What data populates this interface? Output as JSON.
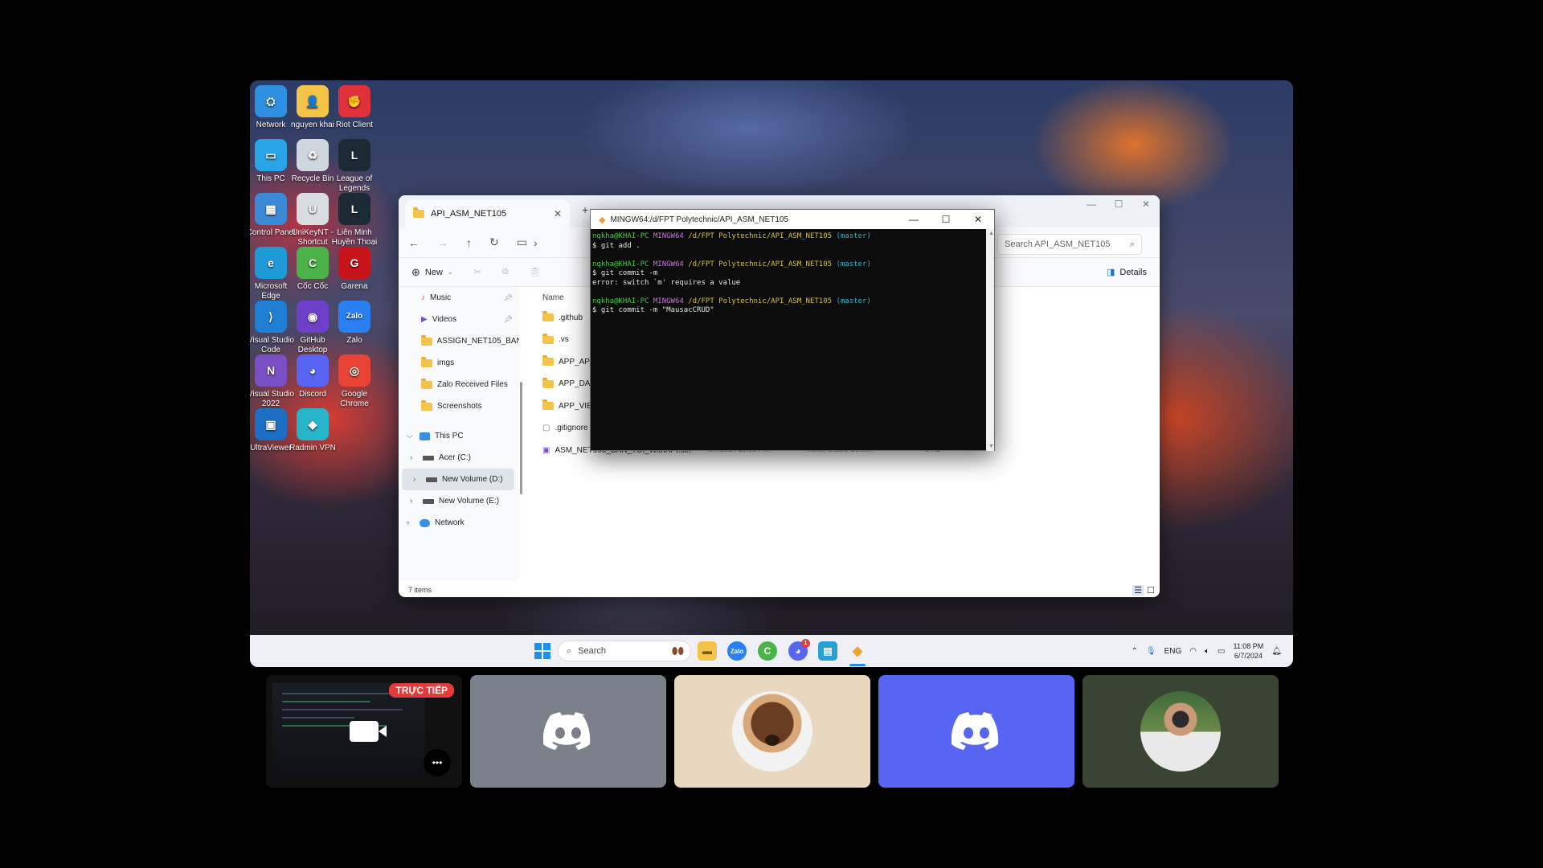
{
  "desktop_icons": [
    {
      "label": "Network",
      "glyph": "⛭",
      "color": "#2f8fe0"
    },
    {
      "label": "nguyen khai",
      "glyph": "👤",
      "color": "#f3c34a"
    },
    {
      "label": "Riot Client",
      "glyph": "✊",
      "color": "#e0313b"
    },
    {
      "label": "This PC",
      "glyph": "▭",
      "color": "#2aa4e8"
    },
    {
      "label": "Recycle Bin",
      "glyph": "♻",
      "color": "#cfd6de"
    },
    {
      "label": "League of Legends",
      "glyph": "L",
      "color": "#1c2a36"
    },
    {
      "label": "Control Panel",
      "glyph": "▦",
      "color": "#3b89d6"
    },
    {
      "label": "UniKeyNT - Shortcut",
      "glyph": "U",
      "color": "#d9dde2"
    },
    {
      "label": "Liên Minh Huyền Thoại",
      "glyph": "L",
      "color": "#1c2a36"
    },
    {
      "label": "Microsoft Edge",
      "glyph": "e",
      "color": "#1e9bd6"
    },
    {
      "label": "Cốc Cốc",
      "glyph": "C",
      "color": "#4cb34a"
    },
    {
      "label": "Garena",
      "glyph": "G",
      "color": "#c7141b"
    },
    {
      "label": "Visual Studio Code",
      "glyph": "⟩",
      "color": "#1f7fd4"
    },
    {
      "label": "GitHub Desktop",
      "glyph": "◉",
      "color": "#6e40c9"
    },
    {
      "label": "Zalo",
      "glyph": "Zalo",
      "color": "#2a7ff2"
    },
    {
      "label": "Visual Studio 2022",
      "glyph": "N",
      "color": "#7b4fc4"
    },
    {
      "label": "Discord",
      "glyph": "◕",
      "color": "#5865f2"
    },
    {
      "label": "Google Chrome",
      "glyph": "◎",
      "color": "#e84335"
    },
    {
      "label": "UltraViewer",
      "glyph": "▣",
      "color": "#1d6fc4"
    },
    {
      "label": "Radmin VPN",
      "glyph": "◆",
      "color": "#28b5c9"
    }
  ],
  "explorer": {
    "tab_title": "API_ASM_NET105",
    "new_tab": "+",
    "search_placeholder": "Search API_ASM_NET105",
    "new_label": "New",
    "details_label": "Details",
    "column_name": "Name",
    "status": "7 items",
    "sidebar": [
      {
        "label": "Music",
        "pinned": true
      },
      {
        "label": "Videos",
        "pinned": true
      },
      {
        "label": "ASSIGN_NET105_BAN"
      },
      {
        "label": "imgs"
      },
      {
        "label": "Zalo Received Files"
      },
      {
        "label": "Screenshots"
      }
    ],
    "tree": [
      {
        "label": "This PC",
        "expand": "⌵"
      },
      {
        "label": "Acer (C:)",
        "expand": "›"
      },
      {
        "label": "New Volume (D:)",
        "expand": "›",
        "selected": true
      },
      {
        "label": "New Volume (E:)",
        "expand": "›"
      },
      {
        "label": "Network",
        "expand": "›"
      }
    ],
    "files": [
      {
        "name": ".github"
      },
      {
        "name": ".vs"
      },
      {
        "name": "APP_API"
      },
      {
        "name": "APP_DATA"
      },
      {
        "name": "APP_VIEW"
      },
      {
        "name": ".gitignore"
      },
      {
        "name": "ASM_NET105_BAN_TUI_WithAPI.sln",
        "date": "6/7/2024 10:56 PM",
        "type": "Visual Studio Solut...",
        "size": "3 KB"
      }
    ]
  },
  "terminal": {
    "title": "MINGW64:/d/FPT Polytechnic/API_ASM_NET105",
    "prompt_user": "nqkha@KHAI-PC",
    "prompt_env": "MINGW64",
    "prompt_path": "/d/FPT Polytechnic/API_ASM_NET105",
    "prompt_branch": "(master)",
    "cmd1": "$ git add .",
    "cmd2": "$ git commit -m",
    "error": "error: switch `m' requires a value",
    "cmd3": "$ git commit -m \"MausacCRUD\""
  },
  "taskbar": {
    "search_placeholder": "Search",
    "lang": "ENG",
    "time": "11:08 PM",
    "date": "6/7/2024",
    "discord_badge": "1"
  },
  "call": {
    "live_badge": "TRỰC TIẾP",
    "more_glyph": "•••",
    "tile_colors": [
      "#111111",
      "#7b808a",
      "#e7d8bf",
      "#5865f2",
      "#3a4433"
    ]
  }
}
